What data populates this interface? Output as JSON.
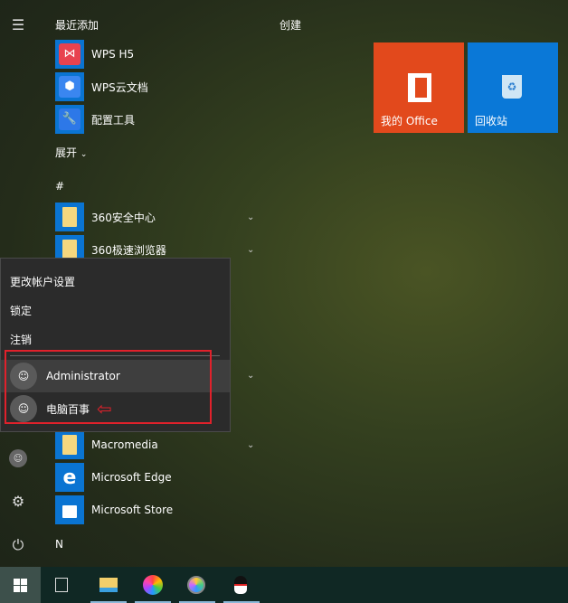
{
  "rail": {
    "icons": [
      "hamburger-icon",
      "user-icon",
      "gear-icon",
      "power-icon"
    ]
  },
  "recent": {
    "header": "最近添加",
    "items": [
      {
        "label": "WPS H5",
        "color": "#e8424f"
      },
      {
        "label": "WPS云文档",
        "color": "#3a86f0"
      },
      {
        "label": "配置工具",
        "color": "#2d78e8"
      }
    ]
  },
  "expand": "展开",
  "groups": {
    "hash": "#",
    "n": "N"
  },
  "apps": [
    {
      "label": "360安全中心",
      "icon": "folder-icon"
    },
    {
      "label": "360极速浏览器",
      "icon": "folder-icon"
    },
    {
      "label": "Macromedia",
      "icon": "folder-icon"
    },
    {
      "label": "Microsoft Edge",
      "icon": "edge-icon"
    },
    {
      "label": "Microsoft Store",
      "icon": "store-icon"
    }
  ],
  "tiles": {
    "header": "创建",
    "items": [
      {
        "label": "我的 Office",
        "color": "#e2491c",
        "icon": "office-icon"
      },
      {
        "label": "回收站",
        "color": "#0a78d7",
        "icon": "recycle-bin-icon"
      }
    ]
  },
  "account_menu": {
    "items": [
      "更改帐户设置",
      "锁定",
      "注销"
    ],
    "users": [
      "Administrator",
      "电脑百事"
    ],
    "highlight_color": "#e0212b"
  },
  "taskbar": {
    "icons": [
      "windows-start-icon",
      "task-view-icon",
      "file-explorer-icon",
      "pinwheel-app-icon",
      "color-app-icon",
      "qq-icon"
    ]
  }
}
